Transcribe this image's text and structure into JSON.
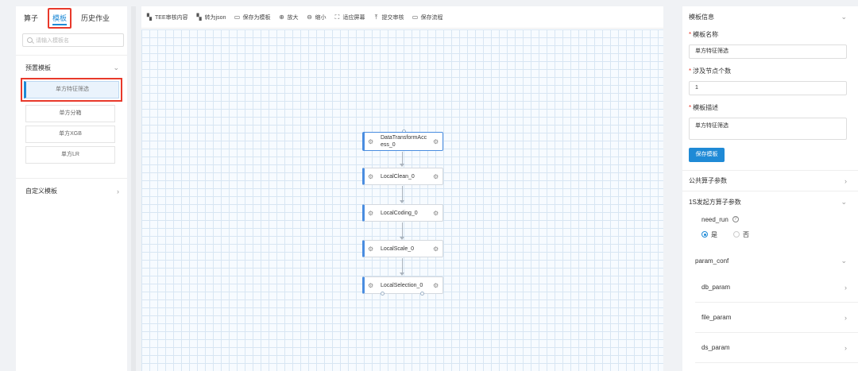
{
  "left": {
    "tabs": [
      {
        "label": "算子"
      },
      {
        "label": "模板"
      },
      {
        "label": "历史作业"
      }
    ],
    "search_placeholder": "请输入模板名",
    "preset_section": "预置模板",
    "templates": [
      "单方特征筛选",
      "单方分箱",
      "单方XGB",
      "单方LR"
    ],
    "custom_section": "自定义模板"
  },
  "toolbar": {
    "items": [
      {
        "label": "TEE审核内容",
        "icon": "grid-icon"
      },
      {
        "label": "转为json",
        "icon": "grid-icon"
      },
      {
        "label": "保存为模板",
        "icon": "folder-icon"
      },
      {
        "label": "放大",
        "icon": "zoom-in-icon"
      },
      {
        "label": "缩小",
        "icon": "zoom-out-icon"
      },
      {
        "label": "适应屏幕",
        "icon": "fit-screen-icon"
      },
      {
        "label": "提交审核",
        "icon": "upload-icon"
      },
      {
        "label": "保存流程",
        "icon": "folder-icon"
      }
    ]
  },
  "flow": {
    "nodes": [
      {
        "label": "DataTransformAcc\ness_0"
      },
      {
        "label": "LocalClean_0"
      },
      {
        "label": "LocalCoding_0"
      },
      {
        "label": "LocalScale_0"
      },
      {
        "label": "LocalSelection_0"
      }
    ]
  },
  "right": {
    "info_title": "模板信息",
    "name_label": "模板名称",
    "name_value": "单方特征筛选",
    "nodes_label": "涉及节点个数",
    "nodes_value": "1",
    "desc_label": "模板描述",
    "desc_value": "单方特征筛选",
    "save_button": "保存模板",
    "public_params": "公共算子参数",
    "initiator_params": "1S发起方算子参数",
    "need_run": "need_run",
    "radio_yes": "是",
    "radio_no": "否",
    "param_conf": "param_conf",
    "sub_params": [
      "db_param",
      "file_param",
      "ds_param"
    ]
  },
  "colors": {
    "accent": "#1f8ad6",
    "highlight_box": "#e8392b",
    "node_accent": "#4a8de0"
  }
}
